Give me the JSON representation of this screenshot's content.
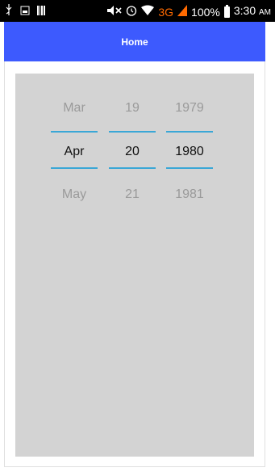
{
  "status_bar": {
    "icons": [
      "usb-icon",
      "screenshot-icon",
      "barcode-icon",
      "mute-icon",
      "alarm-icon",
      "wifi-icon",
      "signal-icon",
      "battery-icon"
    ],
    "network": "3G",
    "battery_percent": "100%",
    "time": "3:30",
    "ampm": "AM"
  },
  "header": {
    "title": "Home",
    "background": "#3d5afe"
  },
  "date_picker": {
    "month": {
      "prev": "Mar",
      "selected": "Apr",
      "next": "May"
    },
    "day": {
      "prev": "19",
      "selected": "20",
      "next": "21"
    },
    "year": {
      "prev": "1979",
      "selected": "1980",
      "next": "1981"
    },
    "divider_color": "#3aa7d6"
  }
}
